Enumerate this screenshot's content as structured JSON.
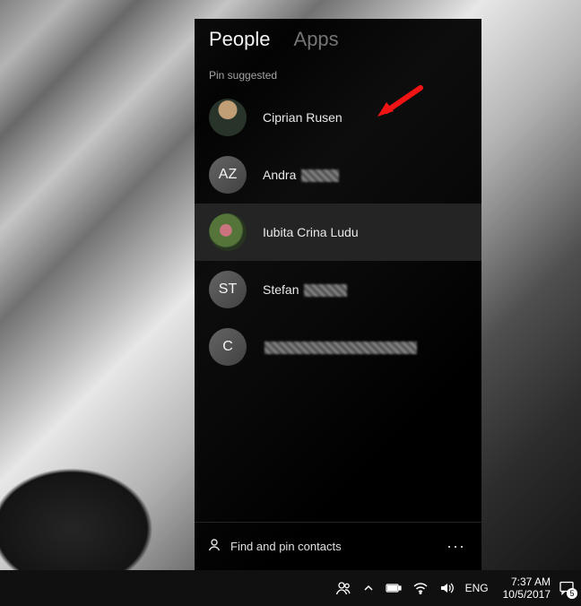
{
  "panel": {
    "tabs": {
      "people": "People",
      "apps": "Apps",
      "active": "people"
    },
    "hint": "Pin suggested",
    "contacts": [
      {
        "name": "Ciprian Rusen",
        "initials": "",
        "hasPhoto": true
      },
      {
        "name": "Andra",
        "initials": "AZ",
        "hasPhoto": false,
        "redacted": true,
        "redactWidth": 42
      },
      {
        "name": "Iubita Crina Ludu",
        "initials": "",
        "hasPhoto": true,
        "hovered": true
      },
      {
        "name": "Stefan",
        "initials": "ST",
        "hasPhoto": false,
        "redacted": true,
        "redactWidth": 48
      },
      {
        "name": "",
        "initials": "C",
        "hasPhoto": false,
        "redacted": true,
        "redactWidth": 170
      }
    ],
    "footer": {
      "find": "Find and pin contacts",
      "more": "···"
    }
  },
  "taskbar": {
    "lang": "ENG",
    "time": "7:37 AM",
    "date": "10/5/2017",
    "badge": "5"
  }
}
